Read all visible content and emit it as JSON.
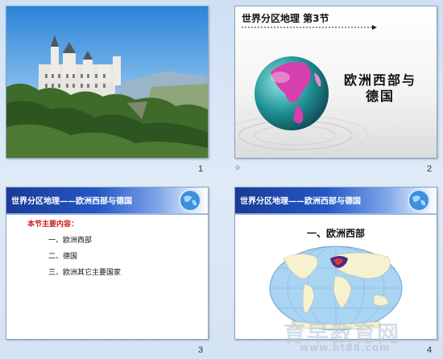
{
  "slides": [
    {
      "number": "1"
    },
    {
      "number": "2",
      "title": "世界分区地理 第3节",
      "main_line1": "欧洲西部与",
      "main_line2": "德国"
    },
    {
      "number": "3",
      "header": "世界分区地理——欧洲西部与德国",
      "intro": "本节主要内容：",
      "items": [
        "一、欧洲西部",
        "二、德国",
        "三、欧洲其它主要国家"
      ]
    },
    {
      "number": "4",
      "header": "世界分区地理——欧洲西部与德国",
      "subtitle": "一、欧洲西部"
    }
  ],
  "notes_icon_label": "☆",
  "watermark": {
    "text": "育早教育网",
    "url": "www.ht88.com"
  },
  "colors": {
    "header_blue": "#1a3b96",
    "intro_red": "#d21a1a"
  }
}
